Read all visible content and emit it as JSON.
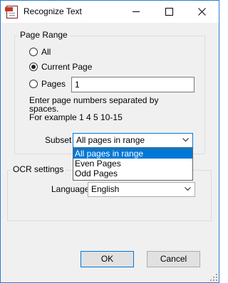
{
  "window": {
    "title": "Recognize Text",
    "controls": {
      "minimize": "minimize-icon",
      "maximize": "maximize-icon",
      "close": "close-icon"
    }
  },
  "page_range": {
    "group_label": "Page Range",
    "options": {
      "all": "All",
      "current": "Current Page",
      "pages": "Pages"
    },
    "selected": "current",
    "pages_value": "1",
    "hint_lines": [
      "Enter page numbers separated by",
      "spaces.",
      "For example 1 4 5 10-15"
    ],
    "subset_label": "Subset",
    "subset_value": "All pages in range",
    "subset_options": [
      "All pages in range",
      "Even Pages",
      "Odd Pages"
    ],
    "subset_highlighted": 0
  },
  "ocr": {
    "group_label": "OCR settings",
    "language_label": "Language",
    "language_value": "English"
  },
  "buttons": {
    "ok": "OK",
    "cancel": "Cancel"
  }
}
